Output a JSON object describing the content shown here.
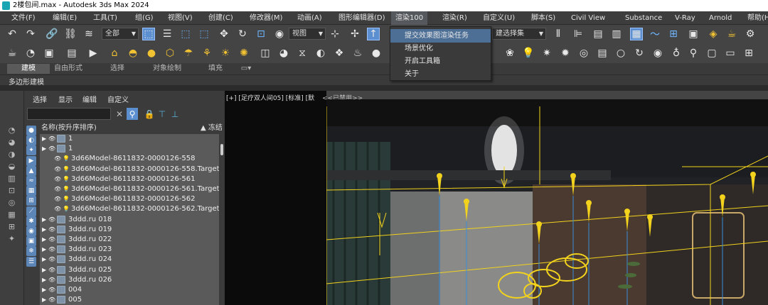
{
  "window": {
    "title": "2楼包间.max - Autodesk 3ds Max 2024"
  },
  "menubar": {
    "items": [
      "文件(F)",
      "编辑(E)",
      "工具(T)",
      "组(G)",
      "视图(V)",
      "创建(C)",
      "修改器(M)",
      "动画(A)",
      "图形编辑器(D)",
      "渲染100",
      "渲染(R)",
      "自定义(U)",
      "脚本(S)",
      "Civil View",
      "Substance",
      "V-Ray",
      "Arnold",
      "帮助(H)"
    ],
    "active": "渲染100"
  },
  "dropdown": {
    "items": [
      "提交效果图渲染任务",
      "场景优化",
      "开启工具箱",
      "关于"
    ],
    "highlighted": "提交效果图渲染任务"
  },
  "toolbar": {
    "selection_filter": "全部",
    "ref_coord": "视图",
    "named_selection": "建选择集"
  },
  "ribbon": {
    "tabs": [
      "建模",
      "自由形式",
      "选择",
      "对象绘制",
      "填充"
    ],
    "active_tab": "建模",
    "sub_label": "多边形建模"
  },
  "scene_explorer": {
    "menu": [
      "选择",
      "显示",
      "编辑",
      "自定义"
    ],
    "column_name": "名称(按升序排序)",
    "column_frozen": "▲ 冻结",
    "rows": [
      {
        "name": "1",
        "expandable": true,
        "kind": "group"
      },
      {
        "name": "1",
        "expandable": true,
        "kind": "group"
      },
      {
        "name": "3d66Model-8611832-0000126-558",
        "expandable": false,
        "kind": "light"
      },
      {
        "name": "3d66Model-8611832-0000126-558.Target",
        "expandable": false,
        "kind": "light"
      },
      {
        "name": "3d66Model-8611832-0000126-561",
        "expandable": false,
        "kind": "light"
      },
      {
        "name": "3d66Model-8611832-0000126-561.Target",
        "expandable": false,
        "kind": "light"
      },
      {
        "name": "3d66Model-8611832-0000126-562",
        "expandable": false,
        "kind": "light"
      },
      {
        "name": "3d66Model-8611832-0000126-562.Target",
        "expandable": false,
        "kind": "light"
      },
      {
        "name": "3ddd.ru 018",
        "expandable": true,
        "kind": "group"
      },
      {
        "name": "3ddd.ru 019",
        "expandable": true,
        "kind": "group"
      },
      {
        "name": "3ddd.ru 022",
        "expandable": true,
        "kind": "group"
      },
      {
        "name": "3ddd.ru 023",
        "expandable": true,
        "kind": "group"
      },
      {
        "name": "3ddd.ru 024",
        "expandable": true,
        "kind": "group"
      },
      {
        "name": "3ddd.ru 025",
        "expandable": true,
        "kind": "group"
      },
      {
        "name": "3ddd.ru 026",
        "expandable": true,
        "kind": "group"
      },
      {
        "name": "004",
        "expandable": true,
        "kind": "group"
      },
      {
        "name": "005",
        "expandable": true,
        "kind": "group"
      }
    ]
  },
  "viewport": {
    "label": "[+] [足疗双人间05] [标准] [默",
    "disabled_note": "<<已禁用>>"
  },
  "colors": {
    "accent": "#5b8fd0",
    "menu_highlight": "#4d6f96",
    "light_gizmo": "#f2d21c"
  }
}
